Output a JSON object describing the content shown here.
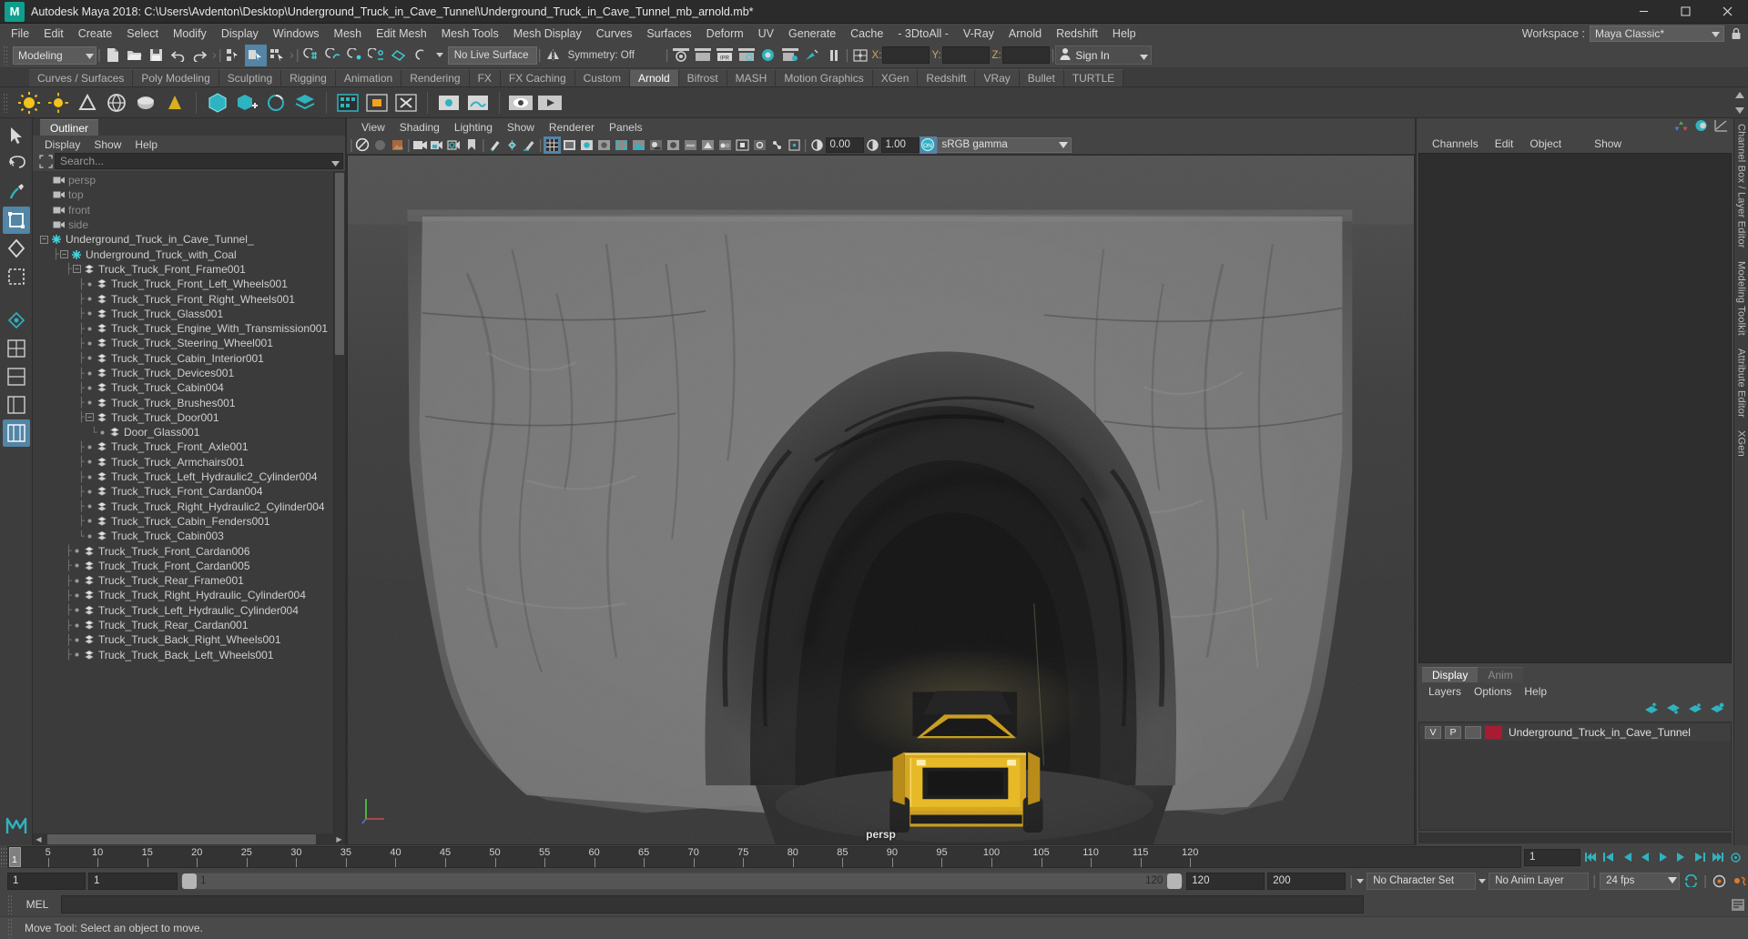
{
  "window": {
    "title": "Autodesk Maya 2018: C:\\Users\\Avdenton\\Desktop\\Underground_Truck_in_Cave_Tunnel\\Underground_Truck_in_Cave_Tunnel_mb_arnold.mb*",
    "minimize": "minimize-icon",
    "maximize": "maximize-icon",
    "close": "close-icon"
  },
  "menubar": {
    "items": [
      "File",
      "Edit",
      "Create",
      "Select",
      "Modify",
      "Display",
      "Windows",
      "Mesh",
      "Edit Mesh",
      "Mesh Tools",
      "Mesh Display",
      "Curves",
      "Surfaces",
      "Deform",
      "UV",
      "Generate",
      "Cache",
      "- 3DtoAll -",
      "V-Ray",
      "Arnold",
      "Redshift",
      "Help"
    ],
    "workspace_label": "Workspace :",
    "workspace_value": "Maya Classic*"
  },
  "statusline": {
    "mode": "Modeling",
    "no_live_surface": "No Live Surface",
    "symmetry": "Symmetry: Off",
    "x_label": "X:",
    "y_label": "Y:",
    "z_label": "Z:",
    "x_value": "",
    "y_value": "",
    "z_value": "",
    "signin": "Sign In"
  },
  "shelf": {
    "tabs": [
      "Curves / Surfaces",
      "Poly Modeling",
      "Sculpting",
      "Rigging",
      "Animation",
      "Rendering",
      "FX",
      "FX Caching",
      "Custom",
      "Arnold",
      "Bifrost",
      "MASH",
      "Motion Graphics",
      "XGen",
      "Redshift",
      "VRay",
      "Bullet",
      "TURTLE"
    ],
    "active_tab": "Arnold"
  },
  "outliner": {
    "tab": "Outliner",
    "menus": [
      "Display",
      "Show",
      "Help"
    ],
    "search_placeholder": "Search...",
    "search_value": "",
    "items": [
      {
        "label": "persp",
        "depth": 2,
        "icon": "camera-icon",
        "dim": true,
        "expander": "none",
        "line": "none"
      },
      {
        "label": "top",
        "depth": 2,
        "icon": "camera-icon",
        "dim": true,
        "expander": "none",
        "line": "none"
      },
      {
        "label": "front",
        "depth": 2,
        "icon": "camera-icon",
        "dim": true,
        "expander": "none",
        "line": "none"
      },
      {
        "label": "side",
        "depth": 2,
        "icon": "camera-icon",
        "dim": true,
        "expander": "none",
        "line": "none"
      },
      {
        "label": "Underground_Truck_in_Cave_Tunnel_",
        "depth": 1,
        "icon": "group-icon",
        "dim": false,
        "expander": "minus",
        "line": "none"
      },
      {
        "label": "Underground_Truck_with_Coal",
        "depth": 2,
        "icon": "group-icon",
        "dim": false,
        "expander": "minus",
        "line": "tee"
      },
      {
        "label": "Truck_Truck_Front_Frame001",
        "depth": 3,
        "icon": "mesh-icon",
        "dim": false,
        "expander": "minus",
        "line": "tee"
      },
      {
        "label": "Truck_Truck_Front_Left_Wheels001",
        "depth": 4,
        "icon": "mesh-icon",
        "dim": false,
        "expander": "dot",
        "line": "tee"
      },
      {
        "label": "Truck_Truck_Front_Right_Wheels001",
        "depth": 4,
        "icon": "mesh-icon",
        "dim": false,
        "expander": "dot",
        "line": "tee"
      },
      {
        "label": "Truck_Truck_Glass001",
        "depth": 4,
        "icon": "mesh-icon",
        "dim": false,
        "expander": "dot",
        "line": "tee"
      },
      {
        "label": "Truck_Truck_Engine_With_Transmission001",
        "depth": 4,
        "icon": "mesh-icon",
        "dim": false,
        "expander": "dot",
        "line": "tee"
      },
      {
        "label": "Truck_Truck_Steering_Wheel001",
        "depth": 4,
        "icon": "mesh-icon",
        "dim": false,
        "expander": "dot",
        "line": "tee"
      },
      {
        "label": "Truck_Truck_Cabin_Interior001",
        "depth": 4,
        "icon": "mesh-icon",
        "dim": false,
        "expander": "dot",
        "line": "tee"
      },
      {
        "label": "Truck_Truck_Devices001",
        "depth": 4,
        "icon": "mesh-icon",
        "dim": false,
        "expander": "dot",
        "line": "tee"
      },
      {
        "label": "Truck_Truck_Cabin004",
        "depth": 4,
        "icon": "mesh-icon",
        "dim": false,
        "expander": "dot",
        "line": "tee"
      },
      {
        "label": "Truck_Truck_Brushes001",
        "depth": 4,
        "icon": "mesh-icon",
        "dim": false,
        "expander": "dot",
        "line": "tee"
      },
      {
        "label": "Truck_Truck_Door001",
        "depth": 4,
        "icon": "mesh-icon",
        "dim": false,
        "expander": "minus",
        "line": "tee"
      },
      {
        "label": "Door_Glass001",
        "depth": 5,
        "icon": "mesh-icon",
        "dim": false,
        "expander": "dot",
        "line": "ell"
      },
      {
        "label": "Truck_Truck_Front_Axle001",
        "depth": 4,
        "icon": "mesh-icon",
        "dim": false,
        "expander": "dot",
        "line": "tee"
      },
      {
        "label": "Truck_Truck_Armchairs001",
        "depth": 4,
        "icon": "mesh-icon",
        "dim": false,
        "expander": "dot",
        "line": "tee"
      },
      {
        "label": "Truck_Truck_Left_Hydraulic2_Cylinder004",
        "depth": 4,
        "icon": "mesh-icon",
        "dim": false,
        "expander": "dot",
        "line": "tee"
      },
      {
        "label": "Truck_Truck_Front_Cardan004",
        "depth": 4,
        "icon": "mesh-icon",
        "dim": false,
        "expander": "dot",
        "line": "tee"
      },
      {
        "label": "Truck_Truck_Right_Hydraulic2_Cylinder004",
        "depth": 4,
        "icon": "mesh-icon",
        "dim": false,
        "expander": "dot",
        "line": "tee"
      },
      {
        "label": "Truck_Truck_Cabin_Fenders001",
        "depth": 4,
        "icon": "mesh-icon",
        "dim": false,
        "expander": "dot",
        "line": "tee"
      },
      {
        "label": "Truck_Truck_Cabin003",
        "depth": 4,
        "icon": "mesh-icon",
        "dim": false,
        "expander": "dot",
        "line": "ell"
      },
      {
        "label": "Truck_Truck_Front_Cardan006",
        "depth": 3,
        "icon": "mesh-icon",
        "dim": false,
        "expander": "dot",
        "line": "tee"
      },
      {
        "label": "Truck_Truck_Front_Cardan005",
        "depth": 3,
        "icon": "mesh-icon",
        "dim": false,
        "expander": "dot",
        "line": "tee"
      },
      {
        "label": "Truck_Truck_Rear_Frame001",
        "depth": 3,
        "icon": "mesh-icon",
        "dim": false,
        "expander": "dot",
        "line": "tee"
      },
      {
        "label": "Truck_Truck_Right_Hydraulic_Cylinder004",
        "depth": 3,
        "icon": "mesh-icon",
        "dim": false,
        "expander": "dot",
        "line": "tee"
      },
      {
        "label": "Truck_Truck_Left_Hydraulic_Cylinder004",
        "depth": 3,
        "icon": "mesh-icon",
        "dim": false,
        "expander": "dot",
        "line": "tee"
      },
      {
        "label": "Truck_Truck_Rear_Cardan001",
        "depth": 3,
        "icon": "mesh-icon",
        "dim": false,
        "expander": "dot",
        "line": "tee"
      },
      {
        "label": "Truck_Truck_Back_Right_Wheels001",
        "depth": 3,
        "icon": "mesh-icon",
        "dim": false,
        "expander": "dot",
        "line": "tee"
      },
      {
        "label": "Truck_Truck_Back_Left_Wheels001",
        "depth": 3,
        "icon": "mesh-icon",
        "dim": false,
        "expander": "dot",
        "line": "tee"
      }
    ]
  },
  "viewport": {
    "menus": [
      "View",
      "Shading",
      "Lighting",
      "Show",
      "Renderer",
      "Panels"
    ],
    "exposure_value": "0.00",
    "gamma_value": "1.00",
    "color_space": "sRGB gamma",
    "camera_label": "persp",
    "scene_description": "Arnold rendered cave tunnel with yellow underground mining truck"
  },
  "channelbox": {
    "tab_labels": [
      "Channels",
      "Edit",
      "Object",
      "Show"
    ],
    "content": ""
  },
  "layer_editor": {
    "tabs": [
      "Display",
      "Anim"
    ],
    "active_tab": "Display",
    "menus": [
      "Layers",
      "Options",
      "Help"
    ],
    "layers": [
      {
        "visibility": "V",
        "playback": "P",
        "color": "#a81b33",
        "name": "Underground_Truck_in_Cave_Tunnel"
      }
    ]
  },
  "right_edge": {
    "labels": [
      "Channel Box / Layer Editor",
      "Modeling Toolkit",
      "Attribute Editor",
      "XGen"
    ]
  },
  "timeline": {
    "current_frame": "1",
    "ticks": [
      5,
      10,
      15,
      20,
      25,
      30,
      35,
      40,
      45,
      50,
      55,
      60,
      65,
      70,
      75,
      80,
      85,
      90,
      95,
      100,
      105,
      110,
      115,
      120
    ],
    "start": 1,
    "end": 122,
    "frame_field": "1"
  },
  "range_slider": {
    "anim_start": "1",
    "range_start": "1",
    "range_bar_start": "1",
    "range_bar_end": "120",
    "range_end": "120",
    "anim_end": "200",
    "character_set": "No Character Set",
    "anim_layer": "No Anim Layer",
    "fps": "24 fps"
  },
  "command_line": {
    "language": "MEL",
    "value": ""
  },
  "help_line": {
    "text": "Move Tool: Select an object to move."
  },
  "colors": {
    "accent": "#5285a6",
    "teal": "#2fb3c0",
    "layer_red": "#a81b33",
    "bg": "#444444",
    "panel_bg": "#3b3b3b",
    "field_bg": "#2e2e2e",
    "orange": "#cfa45a"
  }
}
